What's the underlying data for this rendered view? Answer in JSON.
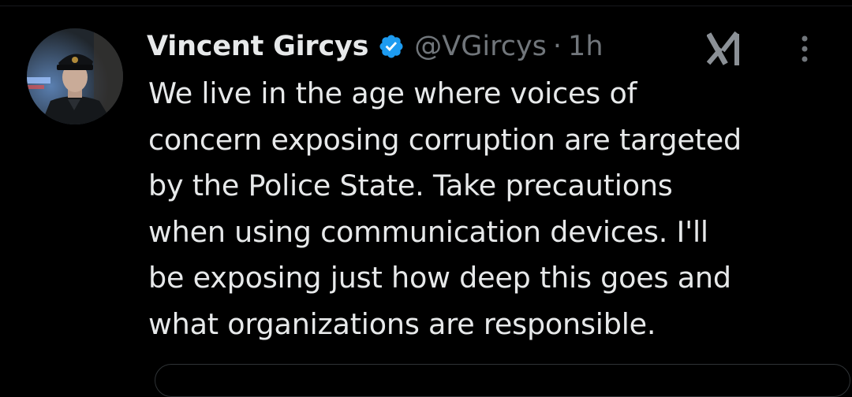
{
  "tweet": {
    "author": {
      "name": "Vincent Gircys",
      "handle": "@VGircys",
      "verified": true,
      "avatar_icon": "police-officer-avatar-icon"
    },
    "separator": "·",
    "timestamp": "1h",
    "actions": {
      "grok_icon": "grok-icon",
      "more_icon": "more-vertical-icon"
    },
    "text": "We live in the age where voices of\nconcern exposing corruption are targeted\nby the Police State. Take precautions\nwhen using communication devices. I'll\nbe exposing just how deep this goes and\nwhat organizations are responsible."
  },
  "colors": {
    "background": "#000000",
    "primary_text": "#e7e9ea",
    "secondary_text": "#71767b",
    "verified_badge": "#1d9bf0",
    "border": "#2f3336"
  }
}
